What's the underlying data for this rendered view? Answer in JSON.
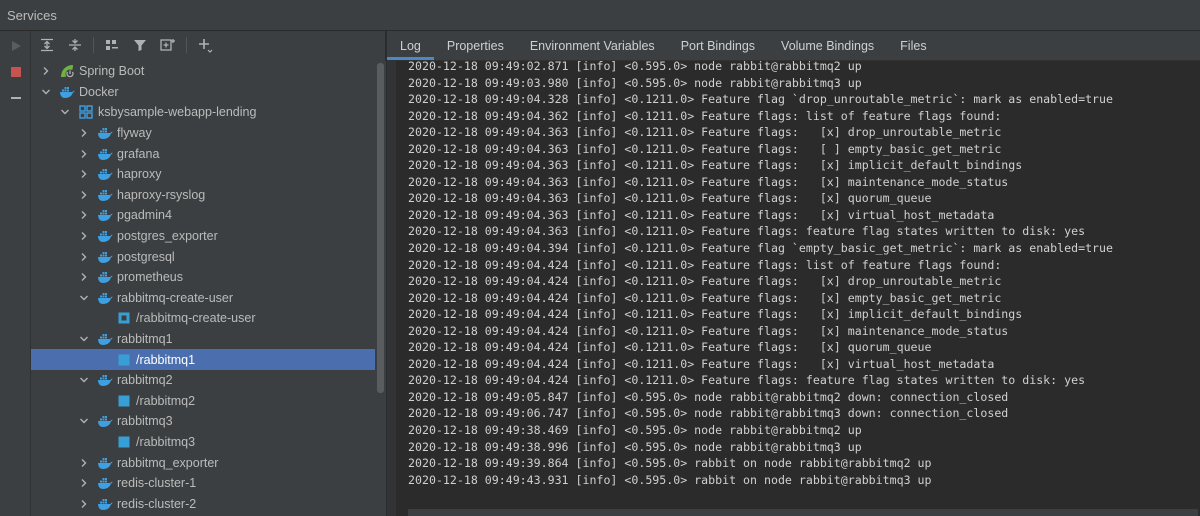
{
  "window": {
    "title": "Services"
  },
  "colors": {
    "selection": "#4b6eaf",
    "docker_blue": "#3e9fe2",
    "spring_green": "#6db33f",
    "stop_red": "#c75450",
    "active_tab": "#4a88c7"
  },
  "tree": {
    "items": [
      {
        "label": "Spring Boot",
        "icon": "spring-boot-icon",
        "expanded": false
      },
      {
        "label": "Docker",
        "icon": "docker-icon",
        "expanded": true
      },
      {
        "label": "ksbysample-webapp-lending",
        "icon": "compose-icon",
        "expanded": true
      },
      {
        "label": "flyway",
        "icon": "docker-icon",
        "expanded": false
      },
      {
        "label": "grafana",
        "icon": "docker-icon",
        "expanded": false
      },
      {
        "label": "haproxy",
        "icon": "docker-icon",
        "expanded": false
      },
      {
        "label": "haproxy-rsyslog",
        "icon": "docker-icon",
        "expanded": false
      },
      {
        "label": "pgadmin4",
        "icon": "docker-icon",
        "expanded": false
      },
      {
        "label": "postgres_exporter",
        "icon": "docker-icon",
        "expanded": false
      },
      {
        "label": "postgresql",
        "icon": "docker-icon",
        "expanded": false
      },
      {
        "label": "prometheus",
        "icon": "docker-icon",
        "expanded": false
      },
      {
        "label": "rabbitmq-create-user",
        "icon": "docker-icon",
        "expanded": true
      },
      {
        "label": "/rabbitmq-create-user",
        "icon": "container-icon"
      },
      {
        "label": "rabbitmq1",
        "icon": "docker-icon",
        "expanded": true
      },
      {
        "label": "/rabbitmq1",
        "icon": "container-icon",
        "selected": true
      },
      {
        "label": "rabbitmq2",
        "icon": "docker-icon",
        "expanded": true
      },
      {
        "label": "/rabbitmq2",
        "icon": "container-icon"
      },
      {
        "label": "rabbitmq3",
        "icon": "docker-icon",
        "expanded": true
      },
      {
        "label": "/rabbitmq3",
        "icon": "container-icon"
      },
      {
        "label": "rabbitmq_exporter",
        "icon": "docker-icon",
        "expanded": false
      },
      {
        "label": "redis-cluster-1",
        "icon": "docker-icon",
        "expanded": false
      },
      {
        "label": "redis-cluster-2",
        "icon": "docker-icon",
        "expanded": false
      }
    ]
  },
  "tabs": [
    {
      "label": "Log",
      "active": true
    },
    {
      "label": "Properties"
    },
    {
      "label": "Environment Variables"
    },
    {
      "label": "Port Bindings"
    },
    {
      "label": "Volume Bindings"
    },
    {
      "label": "Files"
    }
  ],
  "log": {
    "lines": [
      "2020-12-18 09:49:02.871 [info] <0.595.0> node rabbit@rabbitmq2 up",
      "2020-12-18 09:49:03.980 [info] <0.595.0> node rabbit@rabbitmq3 up",
      "2020-12-18 09:49:04.328 [info] <0.1211.0> Feature flag `drop_unroutable_metric`: mark as enabled=true",
      "2020-12-18 09:49:04.362 [info] <0.1211.0> Feature flags: list of feature flags found:",
      "2020-12-18 09:49:04.363 [info] <0.1211.0> Feature flags:   [x] drop_unroutable_metric",
      "2020-12-18 09:49:04.363 [info] <0.1211.0> Feature flags:   [ ] empty_basic_get_metric",
      "2020-12-18 09:49:04.363 [info] <0.1211.0> Feature flags:   [x] implicit_default_bindings",
      "2020-12-18 09:49:04.363 [info] <0.1211.0> Feature flags:   [x] maintenance_mode_status",
      "2020-12-18 09:49:04.363 [info] <0.1211.0> Feature flags:   [x] quorum_queue",
      "2020-12-18 09:49:04.363 [info] <0.1211.0> Feature flags:   [x] virtual_host_metadata",
      "2020-12-18 09:49:04.363 [info] <0.1211.0> Feature flags: feature flag states written to disk: yes",
      "2020-12-18 09:49:04.394 [info] <0.1211.0> Feature flag `empty_basic_get_metric`: mark as enabled=true",
      "2020-12-18 09:49:04.424 [info] <0.1211.0> Feature flags: list of feature flags found:",
      "2020-12-18 09:49:04.424 [info] <0.1211.0> Feature flags:   [x] drop_unroutable_metric",
      "2020-12-18 09:49:04.424 [info] <0.1211.0> Feature flags:   [x] empty_basic_get_metric",
      "2020-12-18 09:49:04.424 [info] <0.1211.0> Feature flags:   [x] implicit_default_bindings",
      "2020-12-18 09:49:04.424 [info] <0.1211.0> Feature flags:   [x] maintenance_mode_status",
      "2020-12-18 09:49:04.424 [info] <0.1211.0> Feature flags:   [x] quorum_queue",
      "2020-12-18 09:49:04.424 [info] <0.1211.0> Feature flags:   [x] virtual_host_metadata",
      "2020-12-18 09:49:04.424 [info] <0.1211.0> Feature flags: feature flag states written to disk: yes",
      "2020-12-18 09:49:05.847 [info] <0.595.0> node rabbit@rabbitmq2 down: connection_closed",
      "2020-12-18 09:49:06.747 [info] <0.595.0> node rabbit@rabbitmq3 down: connection_closed",
      "2020-12-18 09:49:38.469 [info] <0.595.0> node rabbit@rabbitmq2 up",
      "2020-12-18 09:49:38.996 [info] <0.595.0> node rabbit@rabbitmq3 up",
      "2020-12-18 09:49:39.864 [info] <0.595.0> rabbit on node rabbit@rabbitmq2 up",
      "2020-12-18 09:49:43.931 [info] <0.595.0> rabbit on node rabbit@rabbitmq3 up"
    ]
  }
}
